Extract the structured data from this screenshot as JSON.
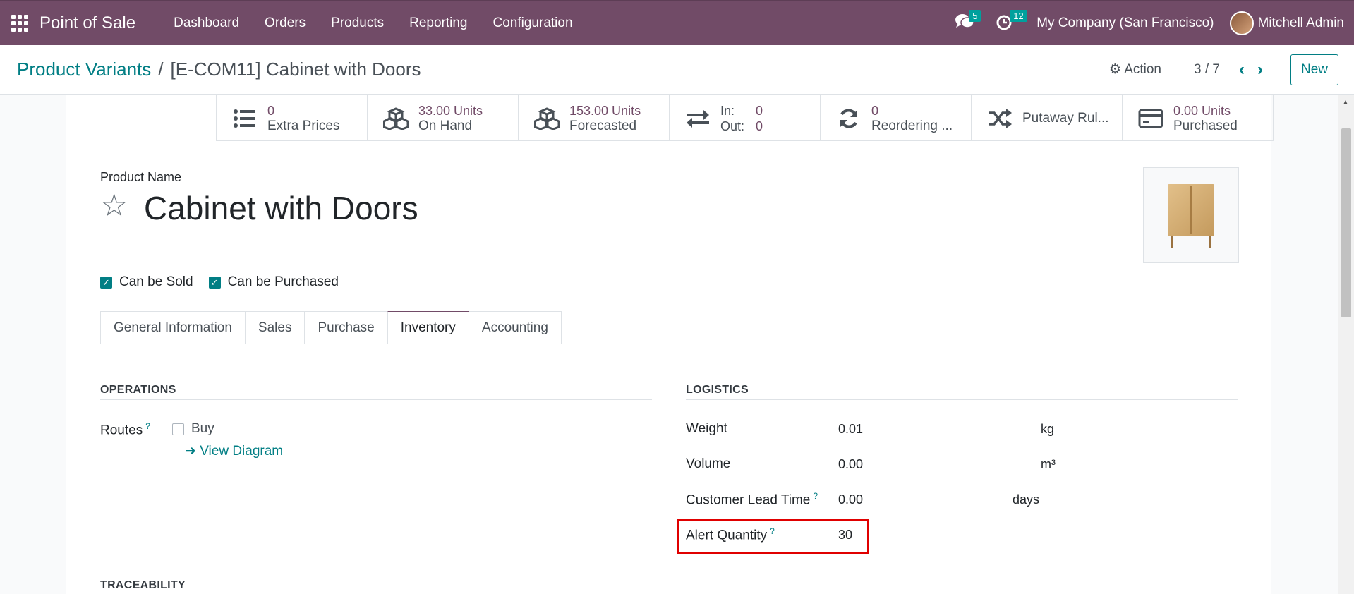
{
  "nav": {
    "app_name": "Point of Sale",
    "menu": [
      "Dashboard",
      "Orders",
      "Products",
      "Reporting",
      "Configuration"
    ],
    "messages_count": "5",
    "activities_count": "12",
    "company": "My Company (San Francisco)",
    "user": "Mitchell Admin",
    "accent_color": "#714B67"
  },
  "control": {
    "breadcrumb_parent": "Product Variants",
    "breadcrumb_separator": "/",
    "breadcrumb_current": "[E-COM11] Cabinet with Doors",
    "action_label": "Action",
    "pager": "3 / 7",
    "new_label": "New"
  },
  "smart_buttons": {
    "extra_prices": {
      "value": "0",
      "label": "Extra Prices",
      "icon": "list-icon"
    },
    "on_hand": {
      "value": "33.00 Units",
      "label": "On Hand",
      "icon": "cubes-icon"
    },
    "forecasted": {
      "value": "153.00 Units",
      "label": "Forecasted",
      "icon": "cubes-icon"
    },
    "in_out": {
      "in_label": "In:",
      "in_value": "0",
      "out_label": "Out:",
      "out_value": "0",
      "icon": "exchange-icon"
    },
    "reordering": {
      "value": "0",
      "label": "Reordering ...",
      "icon": "refresh-icon"
    },
    "putaway": {
      "label": "Putaway Rul...",
      "icon": "random-icon"
    },
    "purchased": {
      "value": "0.00 Units",
      "label": "Purchased",
      "icon": "credit-card-icon"
    }
  },
  "product": {
    "name_label": "Product Name",
    "name": "Cabinet with Doors",
    "can_be_sold": "Can be Sold",
    "can_be_purchased": "Can be Purchased"
  },
  "tabs": [
    "General Information",
    "Sales",
    "Purchase",
    "Inventory",
    "Accounting"
  ],
  "active_tab": "Inventory",
  "operations": {
    "title": "OPERATIONS",
    "routes_label": "Routes",
    "help_mark": "?",
    "route_buy": "Buy",
    "view_diagram": "View Diagram"
  },
  "logistics": {
    "title": "LOGISTICS",
    "weight_label": "Weight",
    "weight_value": "0.01",
    "weight_unit": "kg",
    "volume_label": "Volume",
    "volume_value": "0.00",
    "volume_unit": "m³",
    "lead_label": "Customer Lead Time",
    "lead_value": "0.00",
    "lead_unit": "days",
    "alert_label": "Alert Quantity",
    "alert_value": "30"
  },
  "traceability": {
    "title": "TRACEABILITY"
  }
}
